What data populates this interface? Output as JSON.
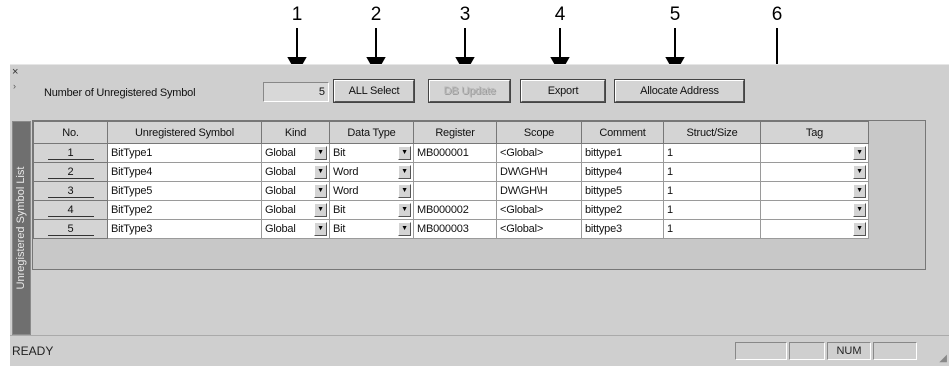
{
  "callouts": [
    "1",
    "2",
    "3",
    "4",
    "5",
    "6"
  ],
  "window": {
    "close_glyph": "×",
    "collapse_glyph": "›",
    "side_tab_label": "Unregistered Symbol List"
  },
  "toolbar": {
    "count_label": "Number of Unregistered Symbol",
    "count_value": "5",
    "all_select_label": "ALL Select",
    "db_update_label": "DB Update",
    "export_label": "Export",
    "allocate_label": "Allocate Address"
  },
  "grid": {
    "headers": [
      "No.",
      "Unregistered Symbol",
      "Kind",
      "Data Type",
      "Register",
      "Scope",
      "Comment",
      "Struct/Size",
      "Tag"
    ],
    "rows": [
      {
        "no": "1",
        "symbol": "BitType1",
        "kind": "Global",
        "data_type": "Bit",
        "register": "MB000001",
        "scope": "<Global>",
        "comment": "bittype1",
        "size": "1",
        "tag": ""
      },
      {
        "no": "2",
        "symbol": "BitType4",
        "kind": "Global",
        "data_type": "Word",
        "register": "",
        "scope": "DW\\GH\\H",
        "comment": "bittype4",
        "size": "1",
        "tag": ""
      },
      {
        "no": "3",
        "symbol": "BitType5",
        "kind": "Global",
        "data_type": "Word",
        "register": "",
        "scope": "DW\\GH\\H",
        "comment": "bittype5",
        "size": "1",
        "tag": ""
      },
      {
        "no": "4",
        "symbol": "BitType2",
        "kind": "Global",
        "data_type": "Bit",
        "register": "MB000002",
        "scope": "<Global>",
        "comment": "bittype2",
        "size": "1",
        "tag": ""
      },
      {
        "no": "5",
        "symbol": "BitType3",
        "kind": "Global",
        "data_type": "Bit",
        "register": "MB000003",
        "scope": "<Global>",
        "comment": "bittype3",
        "size": "1",
        "tag": ""
      }
    ]
  },
  "statusbar": {
    "status": "READY",
    "num_indicator": "NUM"
  }
}
